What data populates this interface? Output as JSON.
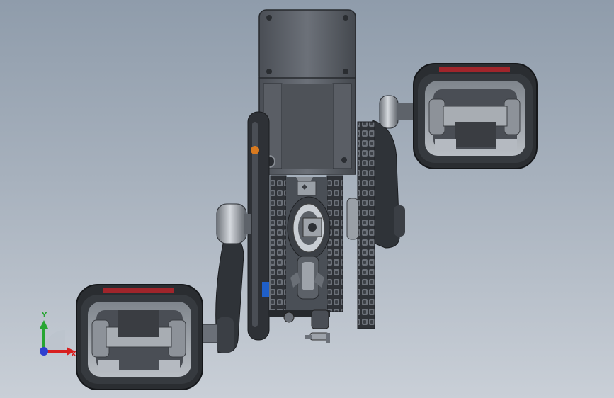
{
  "scene": {
    "background_top": "#8f9cab",
    "background_bottom": "#c9cfd7",
    "model_parts": [
      "motor-block",
      "left-pedal",
      "right-pedal",
      "left-crank-arm",
      "right-crank-arm",
      "chainring",
      "chain",
      "bevel-gear",
      "bearing-housing"
    ]
  },
  "triad": {
    "y_label": "Y",
    "x_label": "X",
    "y_color": "#27a532",
    "x_color": "#d81f1f",
    "z_color": "#2f3fd0"
  },
  "colors": {
    "metal_dark": "#3d4147",
    "metal_mid": "#6b7078",
    "metal_light": "#b5bac1",
    "pedal_trim": "#a0252b",
    "accent_blue": "#1f5fc8",
    "accent_orange": "#d97a1f"
  }
}
